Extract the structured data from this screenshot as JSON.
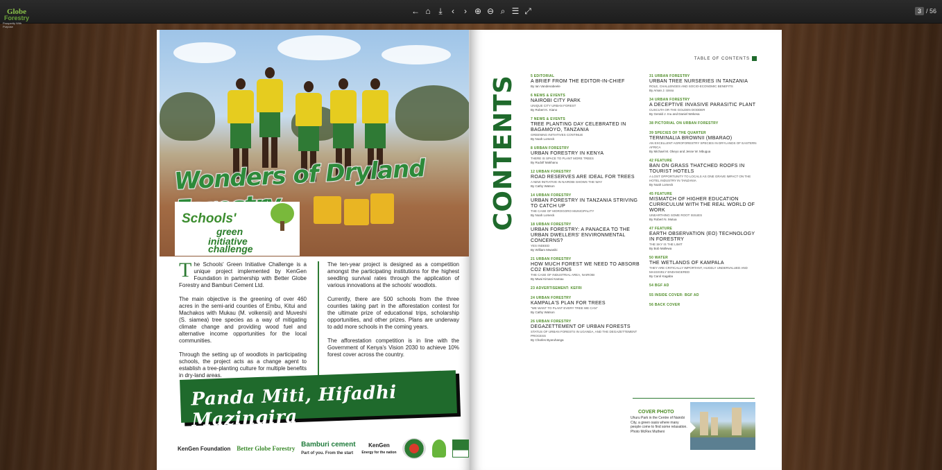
{
  "toolbar": {
    "logo_line1": "Globe",
    "logo_line2": "Forestry",
    "logo_line3": "Prosperity With Purpose",
    "icons": [
      "arrow-left-icon",
      "home-icon",
      "download-icon",
      "chevron-left-icon",
      "chevron-right-icon",
      "zoom-in-icon",
      "zoom-out-icon",
      "search-icon",
      "list-icon",
      "fullscreen-icon"
    ],
    "icon_glyphs": [
      "←",
      "⌂",
      "⤓",
      "‹",
      "›",
      "⊕",
      "⊖",
      "⌕",
      "☰",
      "⤢"
    ],
    "page_current": "3",
    "page_total": "/ 56"
  },
  "left_page": {
    "headline": "Wonders of Dryland Forestry",
    "challenge_line1": "Schools'",
    "challenge_line2": "green",
    "challenge_line3": "initiative",
    "challenge_line4": "challenge",
    "col1_dropcap": "T",
    "col1_p1": "he Schools' Green Initiative Challenge is a unique project implemented by KenGen Foundation in partnership with Better Globe Forestry and Bamburi Cement Ltd.",
    "col1_p2": "The main objective is the greening of over 460 acres in the semi-arid counties of Embu, Kitui and Machakos with Mukau (M. volkensii) and Muveshi (S. siamea) tree species as a way of mitigating climate change and providing wood fuel and alternative income opportunities for the local communities.",
    "col1_p3": "Through the setting up of woodlots in participating schools, the project acts as a change agent to establish a tree-planting culture for multiple benefits in dry-land areas.",
    "col2_p1": "The ten-year project is designed as a competition amongst the participating institutions for the highest seedling survival rates through the application of various innovations at the schools' woodlots.",
    "col2_p2": "Currently, there are 500 schools from the three counties taking part in the afforestation contest for the ultimate prize of educational trips, scholarship opportunities, and other prizes. Plans are underway to add more schools in the coming years.",
    "col2_p3": "The afforestation competition is in line with the Government of Kenya's Vision 2030 to achieve 10% forest cover across the country.",
    "slogan": "Panda Miti, Hifadhi Mazingira",
    "logo_kengen_foundation": "KenGen Foundation",
    "logo_better_globe": "Better Globe Forestry",
    "logo_bamburi": "Bamburi cement",
    "logo_bamburi_tag": "Part of you. From the start",
    "logo_kengen": "KenGen",
    "logo_kengen_tag": "Energy for the nation",
    "logo_nema": "nema",
    "logo_kfs": "KENYA"
  },
  "right_page": {
    "vertical_title": "CONTENTS",
    "toc_label": "TABLE OF CONTENTS",
    "col1": [
      {
        "sec": "5 EDITORIAL",
        "title": "A BRIEF FROM THE EDITOR-IN-CHIEF",
        "sub": "",
        "by": "By Ian Vandenabeele"
      },
      {
        "sec": "6 NEWS & EVENTS",
        "title": "NAIROBI CITY PARK",
        "sub": "UNIQUE CITY URBAN FOREST",
        "by": "By Robert K. Kiano"
      },
      {
        "sec": "7 NEWS & EVENTS",
        "title": "TREE PLANTING DAY CELEBRATED IN BAGAMOYO, TANZANIA",
        "sub": "GREENING INITIATIVES CONTINUE",
        "by": "By Noah Lomeck"
      },
      {
        "sec": "8 URBAN FORESTRY",
        "title": "URBAN FORESTRY IN KENYA",
        "sub": "THERE IS SPACE TO PLANT MORE TREES",
        "by": "By Rudolf Makhanu"
      },
      {
        "sec": "12 URBAN FORESTRY",
        "title": "ROAD RESERVES ARE IDEAL FOR TREES",
        "sub": "A NEW INITIATIVE IN NAIROBI SHOWS THE WAY",
        "by": "By Cathy Watson"
      },
      {
        "sec": "14 URBAN FORESTRY",
        "title": "URBAN FORESTRY IN TANZANIA STRIVING TO CATCH UP",
        "sub": "THE CASE OF MOROGORO MUNICIPALITY",
        "by": "By Noah Lomeck"
      },
      {
        "sec": "18 URBAN FORESTRY",
        "title": "URBAN FORESTRY: A PANACEA TO THE URBAN DWELLERS' ENVIRONMENTAL CONCERNS?",
        "sub": "YES INDEED",
        "by": "By William Mwaniki"
      },
      {
        "sec": "21 URBAN FORESTRY",
        "title": "HOW MUCH FOREST WE NEED TO ABSORB CO2 EMISSIONS",
        "sub": "THE CASE OF INDUSTRIAL AREA, NAIROBI",
        "by": "By Mwai Kimani Kamau"
      },
      {
        "sec": "23 ADVERTISEMENT: KEFRI",
        "title": "",
        "sub": "",
        "by": ""
      },
      {
        "sec": "24 URBAN FORESTRY",
        "title": "KAMPALA'S PLAN FOR TREES",
        "sub": "\"WE WANT TO PLANT EVERY TREE WE CAN\"",
        "by": "By Cathy Watson"
      },
      {
        "sec": "26 URBAN FORESTRY",
        "title": "DEGAZETTEMENT OF URBAN FORESTS",
        "sub": "STATUS OF URBAN FORESTS IN UGANDA, AND THE DEGAZETTEMENT PROCESS",
        "by": "By Charles Byaruhanga"
      }
    ],
    "col2": [
      {
        "sec": "31 URBAN FORESTRY",
        "title": "URBAN TREE NURSERIES IN TANZANIA",
        "sub": "ROLE, CHALLENGES AND SOCIO-ECONOMIC BENEFITS",
        "by": "By Aman J. Uisso"
      },
      {
        "sec": "34 URBAN FORESTRY",
        "title": "A DECEPTIVE INVASIVE PARASITIC PLANT",
        "sub": "CUSCUTA OR THE GOLDEN DODDER",
        "by": "By Gerald J. Inu and Daniel Wekesa"
      },
      {
        "sec": "38 PICTORIAL ON URBAN FORESTRY",
        "title": "",
        "sub": "",
        "by": ""
      },
      {
        "sec": "39 SPECIES OF THE QUARTER",
        "title": "TERMINALIA BROWNII (MBARAO)",
        "sub": "AN EXCELLENT AGROFORESTRY SPECIES IN DRYLANDS OF EASTERN AFRICA",
        "by": "By Michael M. Okeyo and Jesse W. Mbugua"
      },
      {
        "sec": "42 FEATURE",
        "title": "BAN ON GRASS THATCHED ROOFS IN TOURIST HOTELS",
        "sub": "A LOST OPPORTUNITY TO LOCALS AS ONE GRAVE IMPACT ON THE HOTEL INDUSTRY IN TANZANIA",
        "by": "By Noah Lomeck"
      },
      {
        "sec": "45 FEATURE",
        "title": "MISMATCH OF HIGHER EDUCATION CURRICULUM WITH THE REAL WORLD OF WORK",
        "sub": "UNEARTHING SOME ROOT ISSUES",
        "by": "By Robert N. Mutua"
      },
      {
        "sec": "47 FEATURE",
        "title": "EARTH OBSERVATION (EO) TECHNOLOGY IN FORESTRY",
        "sub": "THE SKY IS THE LIMIT",
        "by": "By Bob Mallewa"
      },
      {
        "sec": "50 WATER",
        "title": "THE WETLANDS OF KAMPALA",
        "sub": "THEY ARE CRITICALLY IMPORTANT, HUGELY UNDERVALUED AND MASSIVELY ENDANGERED",
        "by": "By Carol Kagaba"
      },
      {
        "sec": "54 BGF AD",
        "title": "",
        "sub": "",
        "by": ""
      },
      {
        "sec": "55 INSIDE COVER: BGF AD",
        "title": "",
        "sub": "",
        "by": ""
      },
      {
        "sec": "56 BACK COVER",
        "title": "",
        "sub": "",
        "by": ""
      }
    ],
    "cover_photo_label": "COVER PHOTO",
    "cover_caption": "Uhuru Park in the Centre of Nairobi City, a green oasis where many people come to find some relaxation. Photo McRex Mutheni"
  },
  "colors": {
    "toolbar_bg": "#222222",
    "forest_green": "#1f6a2c",
    "section_green": "#4a8a22",
    "shirt_yellow": "#e6cc1f"
  }
}
